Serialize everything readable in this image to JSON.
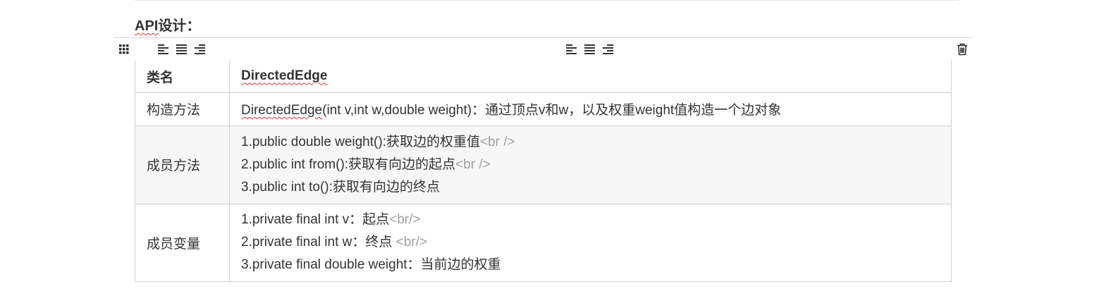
{
  "heading": {
    "prefix": "API",
    "suffix": "设计："
  },
  "toolbar": {
    "icons": [
      "grip-handle-icon",
      "align-left-icon",
      "align-center-icon",
      "align-right-icon",
      "align-left-icon",
      "align-center-icon",
      "align-right-icon",
      "trash-icon"
    ]
  },
  "table": {
    "rows": [
      {
        "key": "类名",
        "value_lines": [
          {
            "text": "DirectedEdge",
            "tag": ""
          }
        ]
      },
      {
        "key": "构造方法",
        "value_prefix": "DirectedEdge",
        "value_rest": "(int v,int w,double weight)：通过顶点v和w，以及权重weight值构造一个边对象"
      },
      {
        "key": "成员方法",
        "value_lines": [
          {
            "text": "1.public double weight():获取边的权重值",
            "tag": "<br />"
          },
          {
            "text": "2.public int from():获取有向边的起点",
            "tag": "<br />"
          },
          {
            "text": "3.public int to():获取有向边的终点",
            "tag": ""
          }
        ]
      },
      {
        "key": "成员变量",
        "value_lines": [
          {
            "text": "1.private final int v：起点",
            "tag": "<br/>"
          },
          {
            "text": "2.private final int w：终点 ",
            "tag": "<br/>"
          },
          {
            "text": "3.private final double weight：当前边的权重",
            "tag": ""
          }
        ]
      }
    ]
  },
  "colors": {
    "text": "#333333",
    "border": "#d0d0d0",
    "shaded_row": "#f7f7f7",
    "tag_gray": "#a0a0a0",
    "spellcheck": "#e0353b"
  }
}
